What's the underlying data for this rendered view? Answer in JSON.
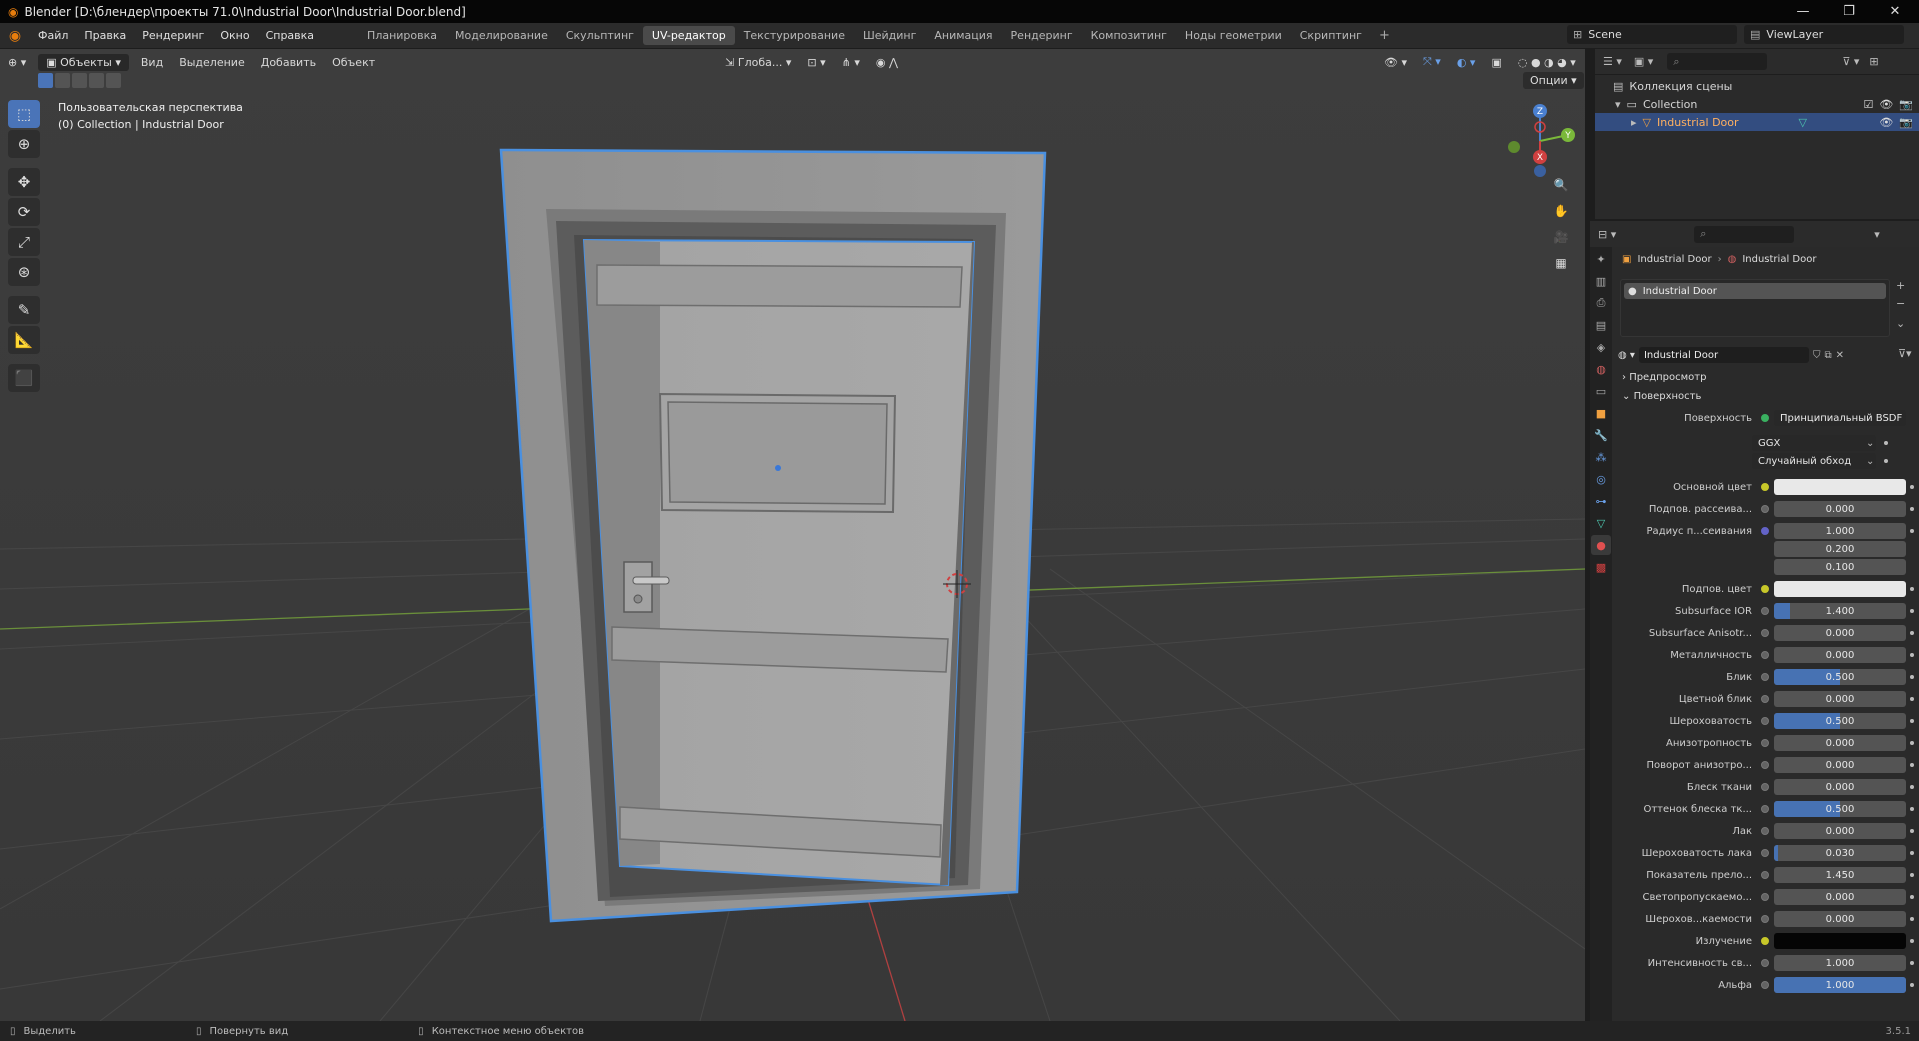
{
  "titlebar": {
    "title": "Blender [D:\\блендер\\проекты 71.0\\Industrial Door\\Industrial Door.blend]"
  },
  "menu": {
    "items": [
      "Файл",
      "Правка",
      "Рендеринг",
      "Окно",
      "Справка"
    ]
  },
  "workspaces": [
    "Планировка",
    "Моделирование",
    "Скульптинг",
    "UV-редактор",
    "Текстурирование",
    "Шейдинг",
    "Анимация",
    "Рендеринг",
    "Композитинг",
    "Ноды геометрии",
    "Скриптинг"
  ],
  "active_workspace": "UV-редактор",
  "scene": {
    "scene_name": "Scene",
    "view_layer": "ViewLayer"
  },
  "viewport": {
    "mode": "Объекты",
    "menu": [
      "Вид",
      "Выделение",
      "Добавить",
      "Объект"
    ],
    "transform": "Глоба...",
    "options_label": "Опции",
    "overlay_line1": "Пользовательская перспектива",
    "overlay_line2": "(0) Collection | Industrial Door",
    "gizmo": {
      "x": "X",
      "y": "Y",
      "z": "Z"
    }
  },
  "outliner": {
    "root": "Коллекция сцены",
    "collection": "Collection",
    "object": "Industrial Door"
  },
  "properties": {
    "breadcrumb_obj": "Industrial Door",
    "breadcrumb_mat": "Industrial Door",
    "slot": "Industrial Door",
    "material_name": "Industrial Door",
    "preview": "Предпросмотр",
    "surface_panel": "Поверхность",
    "surface_label": "Поверхность",
    "surface_value": "Принципиальный BSDF",
    "distribution": "GGX",
    "subsurface_method": "Случайный обход",
    "rows": [
      {
        "label": "Основной цвет",
        "value": "",
        "kind": "color",
        "color": "#e8e8e8"
      },
      {
        "label": "Подпов. рассеива...",
        "value": "0.000",
        "fill": 0
      },
      {
        "label": "Радиус п...сеивания",
        "value": "1.000",
        "fill": 0
      },
      {
        "label": "",
        "value": "0.200",
        "fill": 0
      },
      {
        "label": "",
        "value": "0.100",
        "fill": 0
      },
      {
        "label": "Подпов. цвет",
        "value": "",
        "kind": "color",
        "color": "#e8e8e8"
      },
      {
        "label": "Subsurface IOR",
        "value": "1.400",
        "fill": 0.12
      },
      {
        "label": "Subsurface Anisotr...",
        "value": "0.000",
        "fill": 0
      },
      {
        "label": "Металличность",
        "value": "0.000",
        "fill": 0
      },
      {
        "label": "Блик",
        "value": "0.500",
        "fill": 0.5
      },
      {
        "label": "Цветной блик",
        "value": "0.000",
        "fill": 0
      },
      {
        "label": "Шероховатость",
        "value": "0.500",
        "fill": 0.5
      },
      {
        "label": "Анизотропность",
        "value": "0.000",
        "fill": 0
      },
      {
        "label": "Поворот анизотро...",
        "value": "0.000",
        "fill": 0
      },
      {
        "label": "Блеск ткани",
        "value": "0.000",
        "fill": 0
      },
      {
        "label": "Оттенок блеска тк...",
        "value": "0.500",
        "fill": 0.5
      },
      {
        "label": "Лак",
        "value": "0.000",
        "fill": 0
      },
      {
        "label": "Шероховатость лака",
        "value": "0.030",
        "fill": 0.03
      },
      {
        "label": "Показатель прело...",
        "value": "1.450",
        "fill": 0
      },
      {
        "label": "Светопропускаемо...",
        "value": "0.000",
        "fill": 0
      },
      {
        "label": "Шерохов...каемости",
        "value": "0.000",
        "fill": 0
      },
      {
        "label": "Излучение",
        "value": "",
        "kind": "color",
        "color": "#050505"
      },
      {
        "label": "Интенсивность св...",
        "value": "1.000",
        "fill": 0
      },
      {
        "label": "Альфа",
        "value": "1.000",
        "fill": 1
      }
    ]
  },
  "statusbar": {
    "select": "Выделить",
    "rotate": "Повернуть вид",
    "context": "Контекстное меню объектов",
    "version": "3.5.1"
  },
  "colors": {
    "accent": "#4772b3",
    "selection": "#334d80",
    "outline": "#4a90e0",
    "x_axis": "#d04040",
    "y_axis": "#7ab83a"
  }
}
